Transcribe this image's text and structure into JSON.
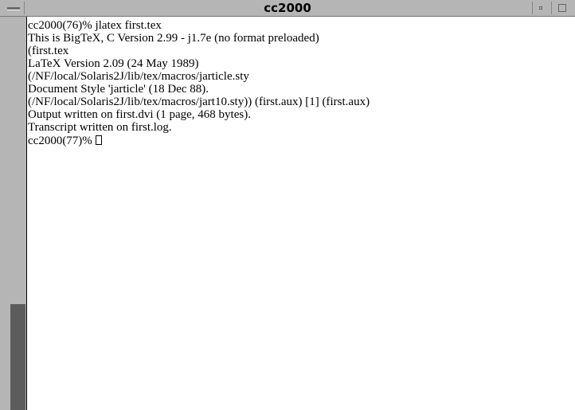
{
  "window": {
    "title": "cc2000"
  },
  "terminal": {
    "lines": [
      "cc2000(76)% jlatex first.tex",
      "This is BigTeX, C Version 2.99 - j1.7e (no format preloaded)",
      "(first.tex",
      "LaTeX Version 2.09 (24 May 1989)",
      "(/NF/local/Solaris2J/lib/tex/macros/jarticle.sty",
      "Document Style 'jarticle' (18 Dec 88).",
      "(/NF/local/Solaris2J/lib/tex/macros/jart10.sty)) (first.aux) [1] (first.aux)",
      "Output written on first.dvi (1 page, 468 bytes).",
      "Transcript written on first.log."
    ],
    "prompt": "cc2000(77)% "
  },
  "scrollbar": {
    "thumb_start_fraction": 0.73,
    "thumb_size_fraction": 0.27
  },
  "icons": {
    "window_menu": "window-menu-icon",
    "minimize": "minimize-icon",
    "maximize": "maximize-icon",
    "cursor": "block-cursor"
  }
}
